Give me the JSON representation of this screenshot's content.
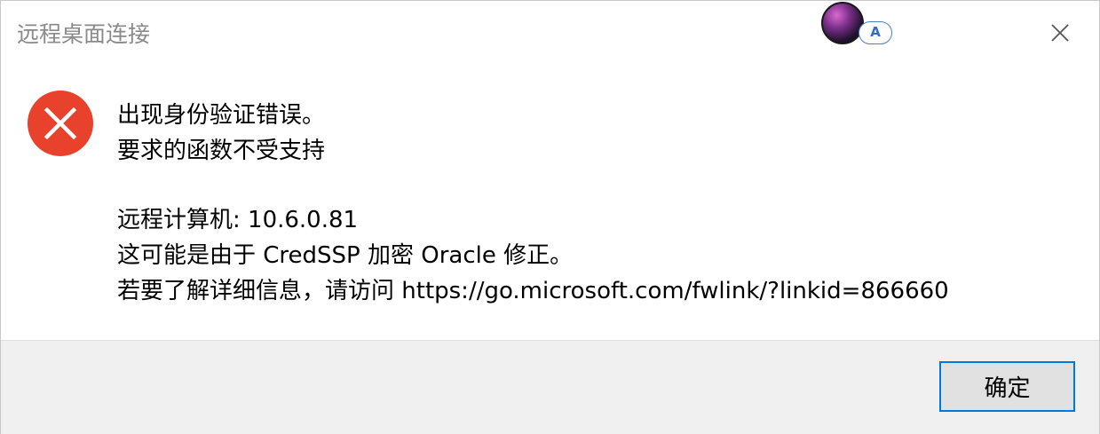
{
  "window": {
    "title": "远程桌面连接"
  },
  "account": {
    "badge_letter": "A"
  },
  "icons": {
    "error": "error-icon",
    "close": "close-icon",
    "avatar": "avatar"
  },
  "colors": {
    "error_red": "#e8412c",
    "accent": "#0078d7",
    "footer_bg": "#f0f0f0"
  },
  "message": {
    "line1": "出现身份验证错误。",
    "line2": "要求的函数不受支持",
    "computer": "远程计算机: 10.6.0.81",
    "reason": "这可能是由于 CredSSP 加密 Oracle 修正。",
    "more_info": "若要了解详细信息，请访问 https://go.microsoft.com/fwlink/?linkid=866660"
  },
  "buttons": {
    "ok_label": "确定"
  }
}
